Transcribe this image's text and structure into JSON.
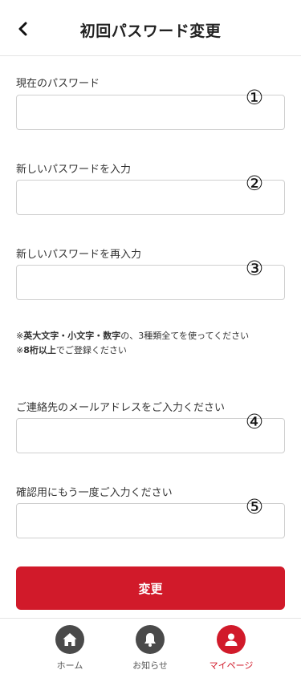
{
  "header": {
    "title": "初回パスワード変更",
    "back_icon": "chevron-left-icon"
  },
  "form": {
    "fields": [
      {
        "label": "現在のパスワード",
        "value": "",
        "marker": "①"
      },
      {
        "label": "新しいパスワードを入力",
        "value": "",
        "marker": "②"
      },
      {
        "label": "新しいパスワードを再入力",
        "value": "",
        "marker": "③"
      },
      {
        "label": "ご連絡先のメールアドレスをご入力ください",
        "value": "",
        "marker": "④"
      },
      {
        "label": "確認用にもう一度ご入力ください",
        "value": "",
        "marker": "⑤"
      }
    ],
    "notes": {
      "line1_prefix": "※",
      "line1_bold": "英大文字・小文字・数字",
      "line1_suffix": "の、3種類全てを使ってください",
      "line2_prefix": "※",
      "line2_bold": "8桁以上",
      "line2_suffix": "でご登録ください"
    },
    "submit_label": "変更"
  },
  "tabbar": {
    "items": [
      {
        "label": "ホーム",
        "icon": "home-icon",
        "active": false
      },
      {
        "label": "お知らせ",
        "icon": "bell-icon",
        "active": false
      },
      {
        "label": "マイページ",
        "icon": "user-icon",
        "active": true
      }
    ]
  },
  "colors": {
    "accent": "#d11a2a",
    "icon_inactive": "#4a4a4a",
    "border": "#cfcfcf"
  }
}
